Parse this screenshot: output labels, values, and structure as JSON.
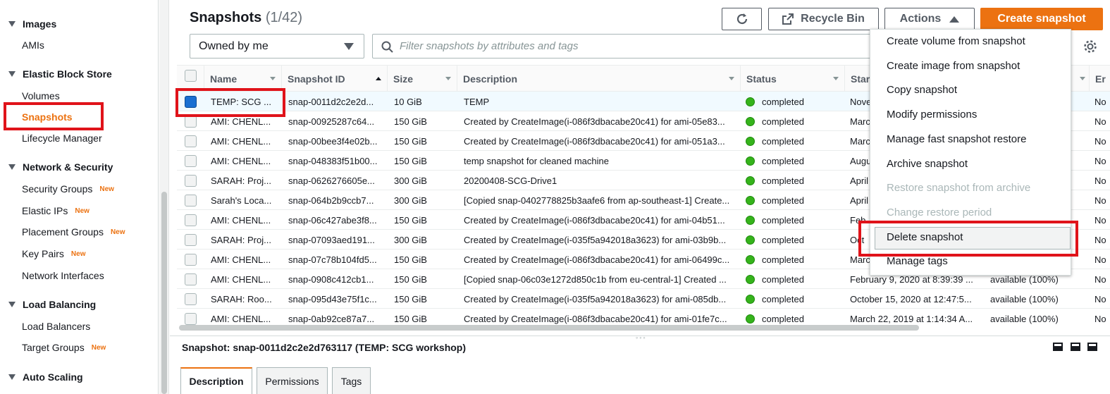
{
  "sidebar": {
    "sections": [
      {
        "label": "Images",
        "items": [
          {
            "label": "AMIs",
            "badge": ""
          }
        ]
      },
      {
        "label": "Elastic Block Store",
        "items": [
          {
            "label": "Volumes",
            "badge": ""
          },
          {
            "label": "Snapshots",
            "badge": ""
          },
          {
            "label": "Lifecycle Manager",
            "badge": ""
          }
        ]
      },
      {
        "label": "Network & Security",
        "items": [
          {
            "label": "Security Groups",
            "badge": "New"
          },
          {
            "label": "Elastic IPs",
            "badge": "New"
          },
          {
            "label": "Placement Groups",
            "badge": "New"
          },
          {
            "label": "Key Pairs",
            "badge": "New"
          },
          {
            "label": "Network Interfaces",
            "badge": ""
          }
        ]
      },
      {
        "label": "Load Balancing",
        "items": [
          {
            "label": "Load Balancers",
            "badge": ""
          },
          {
            "label": "Target Groups",
            "badge": "New"
          }
        ]
      },
      {
        "label": "Auto Scaling",
        "items": []
      }
    ]
  },
  "header": {
    "title": "Snapshots",
    "count": "(1/42)",
    "recycle_bin_label": "Recycle Bin",
    "actions_label": "Actions",
    "create_label": "Create snapshot"
  },
  "filters": {
    "owner_value": "Owned by me",
    "search_placeholder": "Filter snapshots by attributes and tags"
  },
  "table": {
    "columns": [
      "Name",
      "Snapshot ID",
      "Size",
      "Description",
      "Status",
      "Star",
      "",
      "Er"
    ],
    "rows": [
      {
        "name": "TEMP: SCG ...",
        "id": "snap-0011d2c2e2d...",
        "size": "10 GiB",
        "desc": "TEMP",
        "status": "completed",
        "start": "Nove",
        "progress": "",
        "enc": "No"
      },
      {
        "name": "AMI: CHENL...",
        "id": "snap-00925287c64...",
        "size": "150 GiB",
        "desc": "Created by CreateImage(i-086f3dbacabe20c41) for ami-05e83...",
        "status": "completed",
        "start": "Marc",
        "progress": "",
        "enc": "No"
      },
      {
        "name": "AMI: CHENL...",
        "id": "snap-00bee3f4e02b...",
        "size": "150 GiB",
        "desc": "Created by CreateImage(i-086f3dbacabe20c41) for ami-051a3...",
        "status": "completed",
        "start": "Marc",
        "progress": "",
        "enc": "No"
      },
      {
        "name": "AMI: CHENL...",
        "id": "snap-048383f51b00...",
        "size": "150 GiB",
        "desc": "temp snapshot for cleaned machine",
        "status": "completed",
        "start": "Augu",
        "progress": "",
        "enc": "No"
      },
      {
        "name": "SARAH: Proj...",
        "id": "snap-0626276605e...",
        "size": "300 GiB",
        "desc": "20200408-SCG-Drive1",
        "status": "completed",
        "start": "April",
        "progress": "",
        "enc": "No"
      },
      {
        "name": "Sarah's Loca...",
        "id": "snap-064b2b9ccb7...",
        "size": "300 GiB",
        "desc": "[Copied snap-0402778825b3aafe6 from ap-southeast-1] Create...",
        "status": "completed",
        "start": "April",
        "progress": "",
        "enc": "No"
      },
      {
        "name": "AMI: CHENL...",
        "id": "snap-06c427abe3f8...",
        "size": "150 GiB",
        "desc": "Created by CreateImage(i-086f3dbacabe20c41) for ami-04b51...",
        "status": "completed",
        "start": "Feb",
        "progress": "",
        "enc": "No"
      },
      {
        "name": "SARAH: Proj...",
        "id": "snap-07093aed191...",
        "size": "300 GiB",
        "desc": "Created by CreateImage(i-035f5a942018a3623) for ami-03b9b...",
        "status": "completed",
        "start": "Oct",
        "progress": "",
        "enc": "No"
      },
      {
        "name": "AMI: CHENL...",
        "id": "snap-07c78b104fd5...",
        "size": "150 GiB",
        "desc": "Created by CreateImage(i-086f3dbacabe20c41) for ami-06499c...",
        "status": "completed",
        "start": "Marc",
        "progress": "",
        "enc": "No"
      },
      {
        "name": "AMI: CHENL...",
        "id": "snap-0908c412cb1...",
        "size": "150 GiB",
        "desc": "[Copied snap-06c03e1272d850c1b from eu-central-1] Created ...",
        "status": "completed",
        "start": "February 9, 2020 at 8:39:39 ...",
        "progress": "available (100%)",
        "enc": "No"
      },
      {
        "name": "SARAH: Roo...",
        "id": "snap-095d43e75f1c...",
        "size": "150 GiB",
        "desc": "Created by CreateImage(i-035f5a942018a3623) for ami-085db...",
        "status": "completed",
        "start": "October 15, 2020 at 12:47:5...",
        "progress": "available (100%)",
        "enc": "No"
      },
      {
        "name": "AMI: CHENL...",
        "id": "snap-0ab92ce87a7...",
        "size": "150 GiB",
        "desc": "Created by CreateImage(i-086f3dbacabe20c41) for ami-01fe7c...",
        "status": "completed",
        "start": "March 22, 2019 at 1:14:34 A...",
        "progress": "available (100%)",
        "enc": "No"
      }
    ]
  },
  "actions_menu": {
    "items": [
      {
        "label": "Create volume from snapshot",
        "disabled": false
      },
      {
        "label": "Create image from snapshot",
        "disabled": false
      },
      {
        "label": "Copy snapshot",
        "disabled": false
      },
      {
        "label": "Modify permissions",
        "disabled": false
      },
      {
        "label": "Manage fast snapshot restore",
        "disabled": false
      },
      {
        "label": "Archive snapshot",
        "disabled": false
      },
      {
        "label": "Restore snapshot from archive",
        "disabled": true
      },
      {
        "label": "Change restore period",
        "disabled": true
      },
      {
        "label": "Delete snapshot",
        "disabled": false
      },
      {
        "label": "Manage tags",
        "disabled": false
      }
    ]
  },
  "detail": {
    "title": "Snapshot: snap-0011d2c2e2d763117 (TEMP: SCG workshop)",
    "tabs": [
      "Description",
      "Permissions",
      "Tags"
    ]
  },
  "colors": {
    "accent": "#ec7211",
    "status_ok": "#35b31b",
    "highlight": "#e0131a",
    "selected_row": "#f1faff"
  }
}
